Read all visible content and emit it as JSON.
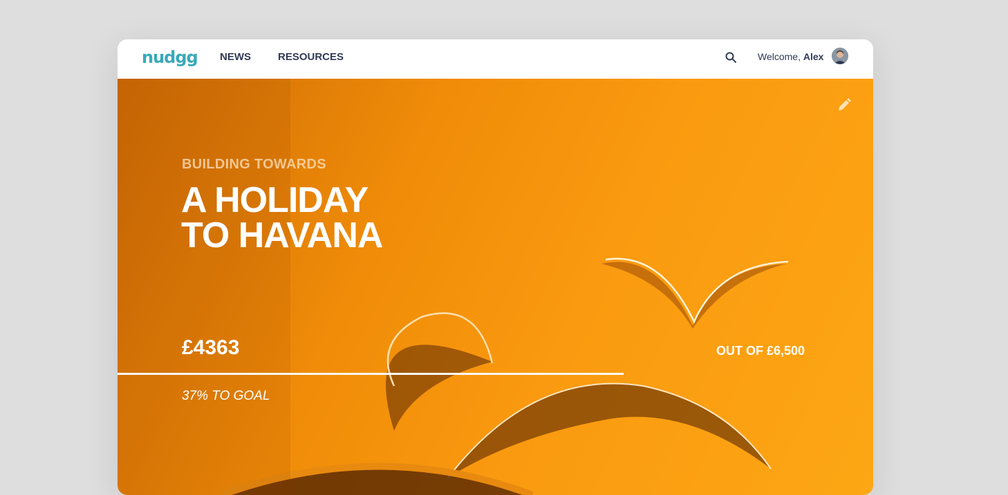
{
  "nav": {
    "logo": "nudgg",
    "links": [
      "NEWS",
      "RESOURCES"
    ],
    "welcome_prefix": "Welcome,",
    "user_name": "Alex",
    "icons": {
      "search": "search-icon",
      "avatar": "user-avatar",
      "edit": "pencil-icon"
    }
  },
  "goal": {
    "eyebrow": "BUILDING TOWARDS",
    "title_line1": "A HOLIDAY",
    "title_line2": "TO HAVANA",
    "saved": "£4363",
    "target_text": "OUT OF £6,500",
    "progress_text": "37% TO GOAL",
    "progress_fraction": 0.67
  },
  "colors": {
    "brand": "#3aa9b8",
    "nav_text": "#2f3a55",
    "hero_dark": "#cc6a05",
    "hero_light": "#fda714"
  }
}
